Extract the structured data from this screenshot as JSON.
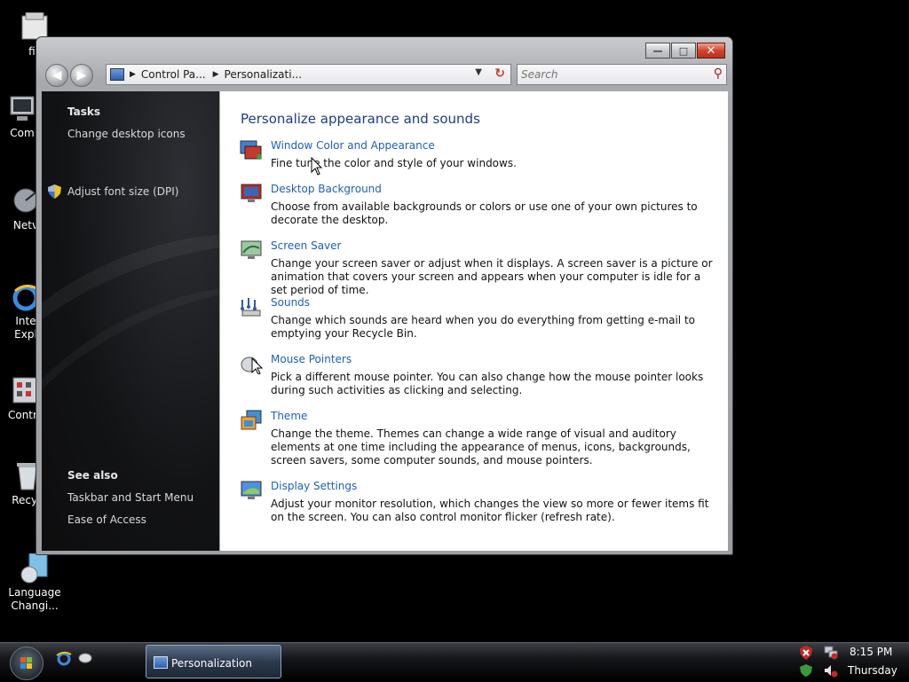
{
  "desktop": {
    "icons": [
      {
        "label": "fis",
        "icon": "folder-icon"
      },
      {
        "label": "Com",
        "icon": "computer-icon"
      },
      {
        "label": "Netv",
        "icon": "network-icon"
      },
      {
        "label": "Inte\nExpl",
        "icon": "internet-explorer-icon"
      },
      {
        "label": "Contro",
        "icon": "control-panel-icon"
      },
      {
        "label": "Recyc",
        "icon": "recycle-bin-icon"
      },
      {
        "label": "Language\nChangi...",
        "icon": "language-changer-icon"
      }
    ]
  },
  "window": {
    "breadcrumbs": [
      "Control Pa...",
      "Personalizati..."
    ],
    "search_placeholder": "Search",
    "side": {
      "tasks_heading": "Tasks",
      "tasks": [
        "Change desktop icons",
        "Adjust font size (DPI)"
      ],
      "see_also_heading": "See also",
      "see_also": [
        "Taskbar and Start Menu",
        "Ease of Access"
      ]
    },
    "main": {
      "heading": "Personalize appearance and sounds",
      "items": [
        {
          "title": "Window Color and Appearance",
          "desc": "Fine tune the color and style of your windows.",
          "icon": "window-color-icon"
        },
        {
          "title": "Desktop Background",
          "desc": "Choose from available backgrounds or colors or use one of your own pictures to decorate the desktop.",
          "icon": "desktop-background-icon"
        },
        {
          "title": "Screen Saver",
          "desc": "Change your screen saver or adjust when it displays. A screen saver is a picture or animation that covers your screen and appears when your computer is idle for a set period of time.",
          "icon": "screen-saver-icon"
        },
        {
          "title": "Sounds",
          "desc": "Change which sounds are heard when you do everything from getting e-mail to emptying your Recycle Bin.",
          "icon": "sounds-icon"
        },
        {
          "title": "Mouse Pointers",
          "desc": "Pick a different mouse pointer. You can also change how the mouse pointer looks during such activities as clicking and selecting.",
          "icon": "mouse-pointers-icon"
        },
        {
          "title": "Theme",
          "desc": "Change the theme. Themes can change a wide range of visual and auditory elements at one time including the appearance of menus, icons, backgrounds, screen savers, some computer sounds, and mouse pointers.",
          "icon": "theme-icon"
        },
        {
          "title": "Display Settings",
          "desc": "Adjust your monitor resolution, which changes the view so more or fewer items fit on the screen. You can also control monitor flicker (refresh rate).",
          "icon": "display-settings-icon"
        }
      ]
    }
  },
  "taskbar": {
    "active_task": "Personalization",
    "time": "8:15 PM",
    "day": "Thursday"
  }
}
